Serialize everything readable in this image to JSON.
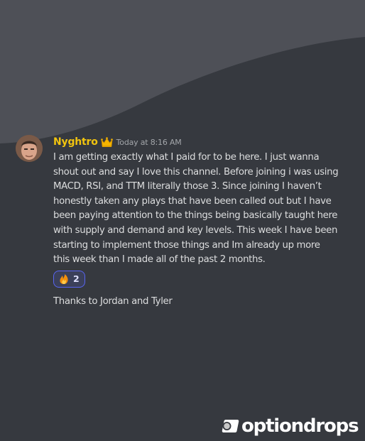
{
  "message": {
    "username": "Nyghtro",
    "timestamp": "Today at 8:16 AM",
    "avatar_alt": "user avatar",
    "lines": [
      "I am getting exactly what I paid for to be here. I just wanna",
      "shout out and say I love this channel. Before joining i was using",
      "MACD, RSI, and TTM literally those 3. Since joining I haven’t",
      "honestly taken any plays that have been called out but I have",
      "been paying attention to the things being basically taught here",
      "with supply and demand and key levels. This week I have been",
      "starting to implement those things and Im already up more",
      "this week than I made all of the past 2 months."
    ],
    "reaction": {
      "emoji": "fire-emoji",
      "count": "2"
    },
    "followup": "Thanks to Jordan and Tyler"
  },
  "brand": {
    "name": "optiondrops"
  },
  "colors": {
    "background": "#36393f",
    "wave": "#4e5057",
    "username": "#f1c40f",
    "text": "#dcddde",
    "timestamp": "#a3a6aa",
    "reaction_border": "#5865f2",
    "reaction_bg": "#3b405a"
  }
}
